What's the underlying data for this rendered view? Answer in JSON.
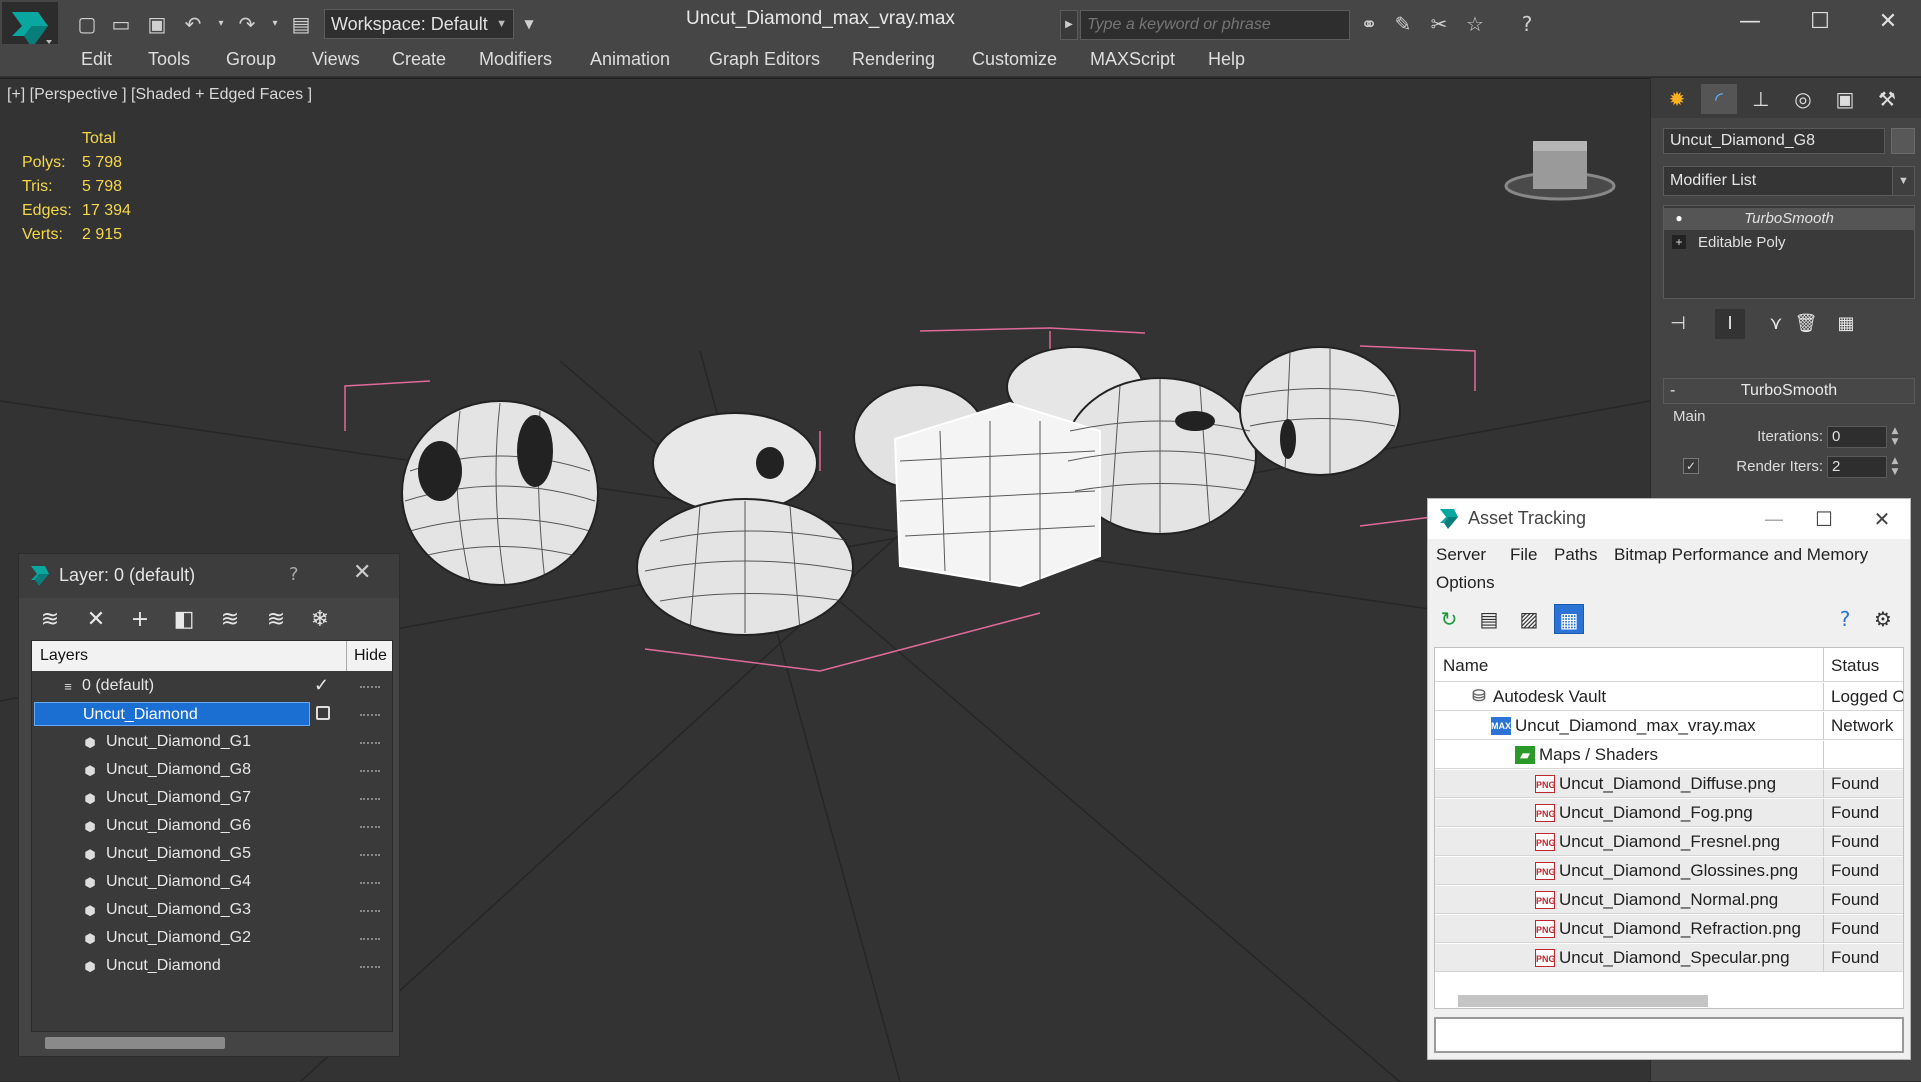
{
  "titlebar": {
    "workspace": "Workspace: Default",
    "file_title": "Uncut_Diamond_max_vray.max",
    "search_placeholder": "Type a keyword or phrase"
  },
  "menu": [
    "Edit",
    "Tools",
    "Group",
    "Views",
    "Create",
    "Modifiers",
    "Animation",
    "Graph Editors",
    "Rendering",
    "Customize",
    "MAXScript",
    "Help"
  ],
  "viewport": {
    "label": "[+] [Perspective ] [Shaded + Edged Faces ]",
    "stats": {
      "header": "Total",
      "rows": [
        {
          "key": "Polys:",
          "value": "5 798"
        },
        {
          "key": "Tris:",
          "value": "5 798"
        },
        {
          "key": "Edges:",
          "value": "17 394"
        },
        {
          "key": "Verts:",
          "value": "2 915"
        }
      ]
    }
  },
  "command_panel": {
    "object_name": "Uncut_Diamond_G8",
    "modifier_list": "Modifier List",
    "stack": [
      "TurboSmooth",
      "Editable Poly"
    ],
    "rollout_title": "TurboSmooth",
    "group_main": "Main",
    "iterations_label": "Iterations:",
    "iterations_value": "0",
    "render_iters_label": "Render Iters:",
    "render_iters_value": "2"
  },
  "layer_window": {
    "title": "Layer: 0 (default)",
    "help": "?",
    "col_layers": "Layers",
    "col_hide": "Hide",
    "rows": [
      {
        "name": "0 (default)",
        "indent": 0
      },
      {
        "name": "Uncut_Diamond",
        "indent": 0,
        "selected": true
      },
      {
        "name": "Uncut_Diamond_G1",
        "indent": 1
      },
      {
        "name": "Uncut_Diamond_G8",
        "indent": 1
      },
      {
        "name": "Uncut_Diamond_G7",
        "indent": 1
      },
      {
        "name": "Uncut_Diamond_G6",
        "indent": 1
      },
      {
        "name": "Uncut_Diamond_G5",
        "indent": 1
      },
      {
        "name": "Uncut_Diamond_G4",
        "indent": 1
      },
      {
        "name": "Uncut_Diamond_G3",
        "indent": 1
      },
      {
        "name": "Uncut_Diamond_G2",
        "indent": 1
      },
      {
        "name": "Uncut_Diamond",
        "indent": 1
      }
    ]
  },
  "asset_window": {
    "title": "Asset Tracking",
    "menu": [
      "Server",
      "File",
      "Paths",
      "Bitmap Performance and Memory",
      "Options"
    ],
    "col_name": "Name",
    "col_status": "Status",
    "rows": [
      {
        "name": "Autodesk Vault",
        "status": "Logged Out",
        "level": 0,
        "icon": "vault-icon"
      },
      {
        "name": "Uncut_Diamond_max_vray.max",
        "status": "Network",
        "level": 1,
        "icon": "max-file-icon"
      },
      {
        "name": "Maps / Shaders",
        "status": "",
        "level": 2,
        "icon": "maps-folder-icon"
      },
      {
        "name": "Uncut_Diamond_Diffuse.png",
        "status": "Found",
        "level": 3,
        "icon": "png-file-icon"
      },
      {
        "name": "Uncut_Diamond_Fog.png",
        "status": "Found",
        "level": 3,
        "icon": "png-file-icon"
      },
      {
        "name": "Uncut_Diamond_Fresnel.png",
        "status": "Found",
        "level": 3,
        "icon": "png-file-icon"
      },
      {
        "name": "Uncut_Diamond_Glossines.png",
        "status": "Found",
        "level": 3,
        "icon": "png-file-icon"
      },
      {
        "name": "Uncut_Diamond_Normal.png",
        "status": "Found",
        "level": 3,
        "icon": "png-file-icon"
      },
      {
        "name": "Uncut_Diamond_Refraction.png",
        "status": "Found",
        "level": 3,
        "icon": "png-file-icon"
      },
      {
        "name": "Uncut_Diamond_Specular.png",
        "status": "Found",
        "level": 3,
        "icon": "png-file-icon"
      }
    ]
  },
  "colors": {
    "stats_text": "#f5d84a",
    "selection_blue": "#1b6fd2",
    "bbox_pink": "#e06a9a"
  }
}
